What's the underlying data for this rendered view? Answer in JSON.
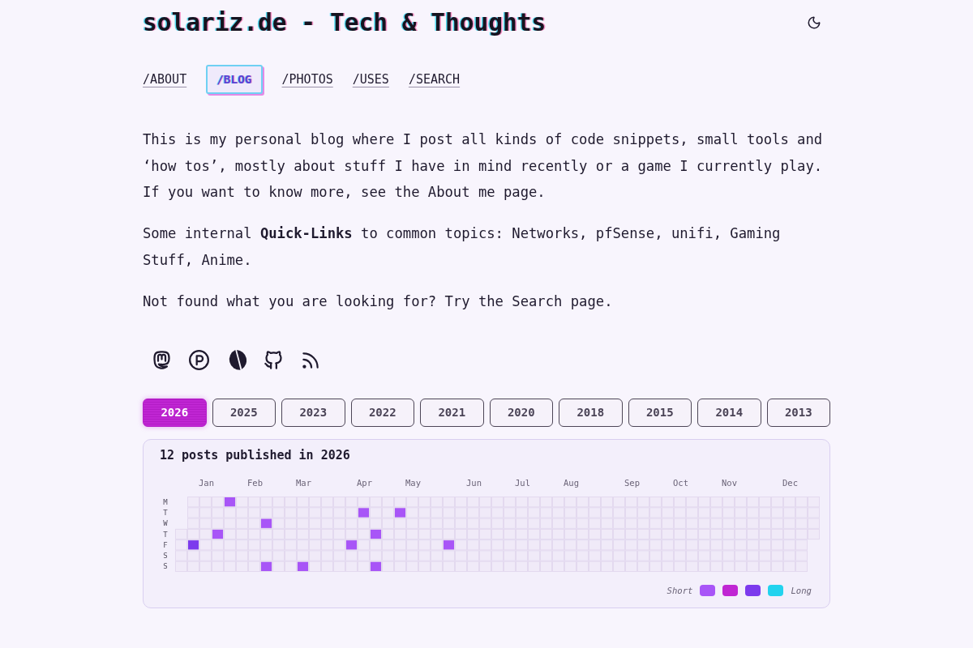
{
  "header": {
    "title": "solariz.de - Tech & Thoughts"
  },
  "nav": [
    {
      "label": "/ABOUT",
      "selected": false
    },
    {
      "label": "/BLOG",
      "selected": true
    },
    {
      "label": "/PHOTOS",
      "selected": false
    },
    {
      "label": "/USES",
      "selected": false
    },
    {
      "label": "/SEARCH",
      "selected": false
    }
  ],
  "intro": {
    "paragraphs": [
      "This is my personal blog where I post all kinds of code snippets, small tools and ‘how tos’, mostly about stuff I have in mind recently or a game I currently play. If you want to know more, see the About me page.",
      "Some internal **Quick-Links** to common topics: Networks, pfSense, unifi, Gaming Stuff, Anime.",
      "Not found what you are looking for? Try the Search page."
    ]
  },
  "years": [
    {
      "label": "2026",
      "selected": true
    },
    {
      "label": "2025",
      "selected": false
    },
    {
      "label": "2023",
      "selected": false
    },
    {
      "label": "2022",
      "selected": false
    },
    {
      "label": "2021",
      "selected": false
    },
    {
      "label": "2020",
      "selected": false
    },
    {
      "label": "2018",
      "selected": false
    },
    {
      "label": "2015",
      "selected": false
    },
    {
      "label": "2014",
      "selected": false
    },
    {
      "label": "2013",
      "selected": false
    }
  ],
  "activity": {
    "title": "12 posts published in 2026",
    "weekdays": [
      "M",
      "T",
      "W",
      "T",
      "F",
      "S",
      "S"
    ],
    "weeks": [
      {
        "kind": "start",
        "days": [
          {
            "posted": false
          },
          {
            "posted": false
          },
          {
            "posted": false
          },
          {
            "posted": false
          }
        ]
      },
      {
        "kind": "full",
        "days": [
          {
            "posted": false
          },
          {
            "posted": false
          },
          {
            "posted": false
          },
          {
            "posted": false
          },
          {
            "posted": true,
            "color": "#7c3aed"
          },
          {
            "posted": false
          },
          {
            "posted": false
          }
        ]
      },
      {
        "kind": "full",
        "month": "Jan",
        "days": [
          {
            "posted": false
          },
          {
            "posted": false
          },
          {
            "posted": false
          },
          {
            "posted": false
          },
          {
            "posted": false
          },
          {
            "posted": false
          },
          {
            "posted": false
          }
        ]
      },
      {
        "kind": "full",
        "days": [
          {
            "posted": false
          },
          {
            "posted": false
          },
          {
            "posted": false
          },
          {
            "posted": true,
            "color": "#a855f7"
          },
          {
            "posted": false
          },
          {
            "posted": false
          },
          {
            "posted": false
          }
        ]
      },
      {
        "kind": "full",
        "days": [
          {
            "posted": true,
            "color": "#a855f7"
          },
          {
            "posted": false
          },
          {
            "posted": false
          },
          {
            "posted": false
          },
          {
            "posted": false
          },
          {
            "posted": false
          },
          {
            "posted": false
          }
        ]
      },
      {
        "kind": "full",
        "days": [
          {
            "posted": false
          },
          {
            "posted": false
          },
          {
            "posted": false
          },
          {
            "posted": false
          },
          {
            "posted": false
          },
          {
            "posted": false
          },
          {
            "posted": false
          }
        ]
      },
      {
        "kind": "full",
        "month": "Feb",
        "days": [
          {
            "posted": false
          },
          {
            "posted": false
          },
          {
            "posted": false
          },
          {
            "posted": false
          },
          {
            "posted": false
          },
          {
            "posted": false
          },
          {
            "posted": false
          }
        ]
      },
      {
        "kind": "full",
        "days": [
          {
            "posted": false
          },
          {
            "posted": false
          },
          {
            "posted": true,
            "color": "#a855f7"
          },
          {
            "posted": false
          },
          {
            "posted": false
          },
          {
            "posted": false
          },
          {
            "posted": true,
            "color": "#a855f7"
          }
        ]
      },
      {
        "kind": "full",
        "days": [
          {
            "posted": false
          },
          {
            "posted": false
          },
          {
            "posted": false
          },
          {
            "posted": false
          },
          {
            "posted": false
          },
          {
            "posted": false
          },
          {
            "posted": false
          }
        ]
      },
      {
        "kind": "full",
        "days": [
          {
            "posted": false
          },
          {
            "posted": false
          },
          {
            "posted": false
          },
          {
            "posted": false
          },
          {
            "posted": false
          },
          {
            "posted": false
          },
          {
            "posted": false
          }
        ]
      },
      {
        "kind": "full",
        "month": "Mar",
        "days": [
          {
            "posted": false
          },
          {
            "posted": false
          },
          {
            "posted": false
          },
          {
            "posted": false
          },
          {
            "posted": false
          },
          {
            "posted": false
          },
          {
            "posted": true,
            "color": "#a855f7"
          }
        ]
      },
      {
        "kind": "full",
        "days": [
          {
            "posted": false
          },
          {
            "posted": false
          },
          {
            "posted": false
          },
          {
            "posted": false
          },
          {
            "posted": false
          },
          {
            "posted": false
          },
          {
            "posted": false
          }
        ]
      },
      {
        "kind": "full",
        "days": [
          {
            "posted": false
          },
          {
            "posted": false
          },
          {
            "posted": false
          },
          {
            "posted": false
          },
          {
            "posted": false
          },
          {
            "posted": false
          },
          {
            "posted": false
          }
        ]
      },
      {
        "kind": "full",
        "days": [
          {
            "posted": false
          },
          {
            "posted": false
          },
          {
            "posted": false
          },
          {
            "posted": false
          },
          {
            "posted": false
          },
          {
            "posted": false
          },
          {
            "posted": false
          }
        ]
      },
      {
        "kind": "full",
        "days": [
          {
            "posted": false
          },
          {
            "posted": false
          },
          {
            "posted": false
          },
          {
            "posted": false
          },
          {
            "posted": true,
            "color": "#a855f7"
          },
          {
            "posted": false
          },
          {
            "posted": false
          }
        ]
      },
      {
        "kind": "full",
        "month": "Apr",
        "days": [
          {
            "posted": false
          },
          {
            "posted": true,
            "color": "#a855f7"
          },
          {
            "posted": false
          },
          {
            "posted": false
          },
          {
            "posted": false
          },
          {
            "posted": false
          },
          {
            "posted": false
          }
        ]
      },
      {
        "kind": "full",
        "days": [
          {
            "posted": false
          },
          {
            "posted": false
          },
          {
            "posted": false
          },
          {
            "posted": true,
            "color": "#a855f7"
          },
          {
            "posted": false
          },
          {
            "posted": false
          },
          {
            "posted": true,
            "color": "#a855f7"
          }
        ]
      },
      {
        "kind": "full",
        "days": [
          {
            "posted": false
          },
          {
            "posted": false
          },
          {
            "posted": false
          },
          {
            "posted": false
          },
          {
            "posted": false
          },
          {
            "posted": false
          },
          {
            "posted": false
          }
        ]
      },
      {
        "kind": "full",
        "days": [
          {
            "posted": false
          },
          {
            "posted": true,
            "color": "#a855f7"
          },
          {
            "posted": false
          },
          {
            "posted": false
          },
          {
            "posted": false
          },
          {
            "posted": false
          },
          {
            "posted": false
          }
        ]
      },
      {
        "kind": "full",
        "month": "May",
        "days": [
          {
            "posted": false
          },
          {
            "posted": false
          },
          {
            "posted": false
          },
          {
            "posted": false
          },
          {
            "posted": false
          },
          {
            "posted": false
          },
          {
            "posted": false
          }
        ]
      },
      {
        "kind": "full",
        "days": [
          {
            "posted": false
          },
          {
            "posted": false
          },
          {
            "posted": false
          },
          {
            "posted": false
          },
          {
            "posted": false
          },
          {
            "posted": false
          },
          {
            "posted": false
          }
        ]
      },
      {
        "kind": "full",
        "days": [
          {
            "posted": false
          },
          {
            "posted": false
          },
          {
            "posted": false
          },
          {
            "posted": false
          },
          {
            "posted": false
          },
          {
            "posted": false
          },
          {
            "posted": false
          }
        ]
      },
      {
        "kind": "full",
        "days": [
          {
            "posted": false
          },
          {
            "posted": false
          },
          {
            "posted": false
          },
          {
            "posted": false
          },
          {
            "posted": true,
            "color": "#a855f7"
          },
          {
            "posted": false
          },
          {
            "posted": false
          }
        ]
      },
      {
        "kind": "full",
        "days": [
          {
            "posted": false
          },
          {
            "posted": false
          },
          {
            "posted": false
          },
          {
            "posted": false
          },
          {
            "posted": false
          },
          {
            "posted": false
          },
          {
            "posted": false
          }
        ]
      },
      {
        "kind": "full",
        "month": "Jun",
        "days": [
          {
            "posted": false
          },
          {
            "posted": false
          },
          {
            "posted": false
          },
          {
            "posted": false
          },
          {
            "posted": false
          },
          {
            "posted": false
          },
          {
            "posted": false
          }
        ]
      },
      {
        "kind": "full",
        "days": [
          {
            "posted": false
          },
          {
            "posted": false
          },
          {
            "posted": false
          },
          {
            "posted": false
          },
          {
            "posted": false
          },
          {
            "posted": false
          },
          {
            "posted": false
          }
        ]
      },
      {
        "kind": "full",
        "days": [
          {
            "posted": false
          },
          {
            "posted": false
          },
          {
            "posted": false
          },
          {
            "posted": false
          },
          {
            "posted": false
          },
          {
            "posted": false
          },
          {
            "posted": false
          }
        ]
      },
      {
        "kind": "full",
        "days": [
          {
            "posted": false
          },
          {
            "posted": false
          },
          {
            "posted": false
          },
          {
            "posted": false
          },
          {
            "posted": false
          },
          {
            "posted": false
          },
          {
            "posted": false
          }
        ]
      },
      {
        "kind": "full",
        "month": "Jul",
        "days": [
          {
            "posted": false
          },
          {
            "posted": false
          },
          {
            "posted": false
          },
          {
            "posted": false
          },
          {
            "posted": false
          },
          {
            "posted": false
          },
          {
            "posted": false
          }
        ]
      },
      {
        "kind": "full",
        "days": [
          {
            "posted": false
          },
          {
            "posted": false
          },
          {
            "posted": false
          },
          {
            "posted": false
          },
          {
            "posted": false
          },
          {
            "posted": false
          },
          {
            "posted": false
          }
        ]
      },
      {
        "kind": "full",
        "days": [
          {
            "posted": false
          },
          {
            "posted": false
          },
          {
            "posted": false
          },
          {
            "posted": false
          },
          {
            "posted": false
          },
          {
            "posted": false
          },
          {
            "posted": false
          }
        ]
      },
      {
        "kind": "full",
        "days": [
          {
            "posted": false
          },
          {
            "posted": false
          },
          {
            "posted": false
          },
          {
            "posted": false
          },
          {
            "posted": false
          },
          {
            "posted": false
          },
          {
            "posted": false
          }
        ]
      },
      {
        "kind": "full",
        "month": "Aug",
        "days": [
          {
            "posted": false
          },
          {
            "posted": false
          },
          {
            "posted": false
          },
          {
            "posted": false
          },
          {
            "posted": false
          },
          {
            "posted": false
          },
          {
            "posted": false
          }
        ]
      },
      {
        "kind": "full",
        "days": [
          {
            "posted": false
          },
          {
            "posted": false
          },
          {
            "posted": false
          },
          {
            "posted": false
          },
          {
            "posted": false
          },
          {
            "posted": false
          },
          {
            "posted": false
          }
        ]
      },
      {
        "kind": "full",
        "days": [
          {
            "posted": false
          },
          {
            "posted": false
          },
          {
            "posted": false
          },
          {
            "posted": false
          },
          {
            "posted": false
          },
          {
            "posted": false
          },
          {
            "posted": false
          }
        ]
      },
      {
        "kind": "full",
        "days": [
          {
            "posted": false
          },
          {
            "posted": false
          },
          {
            "posted": false
          },
          {
            "posted": false
          },
          {
            "posted": false
          },
          {
            "posted": false
          },
          {
            "posted": false
          }
        ]
      },
      {
        "kind": "full",
        "days": [
          {
            "posted": false
          },
          {
            "posted": false
          },
          {
            "posted": false
          },
          {
            "posted": false
          },
          {
            "posted": false
          },
          {
            "posted": false
          },
          {
            "posted": false
          }
        ]
      },
      {
        "kind": "full",
        "month": "Sep",
        "days": [
          {
            "posted": false
          },
          {
            "posted": false
          },
          {
            "posted": false
          },
          {
            "posted": false
          },
          {
            "posted": false
          },
          {
            "posted": false
          },
          {
            "posted": false
          }
        ]
      },
      {
        "kind": "full",
        "days": [
          {
            "posted": false
          },
          {
            "posted": false
          },
          {
            "posted": false
          },
          {
            "posted": false
          },
          {
            "posted": false
          },
          {
            "posted": false
          },
          {
            "posted": false
          }
        ]
      },
      {
        "kind": "full",
        "days": [
          {
            "posted": false
          },
          {
            "posted": false
          },
          {
            "posted": false
          },
          {
            "posted": false
          },
          {
            "posted": false
          },
          {
            "posted": false
          },
          {
            "posted": false
          }
        ]
      },
      {
        "kind": "full",
        "days": [
          {
            "posted": false
          },
          {
            "posted": false
          },
          {
            "posted": false
          },
          {
            "posted": false
          },
          {
            "posted": false
          },
          {
            "posted": false
          },
          {
            "posted": false
          }
        ]
      },
      {
        "kind": "full",
        "month": "Oct",
        "days": [
          {
            "posted": false
          },
          {
            "posted": false
          },
          {
            "posted": false
          },
          {
            "posted": false
          },
          {
            "posted": false
          },
          {
            "posted": false
          },
          {
            "posted": false
          }
        ]
      },
      {
        "kind": "full",
        "days": [
          {
            "posted": false
          },
          {
            "posted": false
          },
          {
            "posted": false
          },
          {
            "posted": false
          },
          {
            "posted": false
          },
          {
            "posted": false
          },
          {
            "posted": false
          }
        ]
      },
      {
        "kind": "full",
        "days": [
          {
            "posted": false
          },
          {
            "posted": false
          },
          {
            "posted": false
          },
          {
            "posted": false
          },
          {
            "posted": false
          },
          {
            "posted": false
          },
          {
            "posted": false
          }
        ]
      },
      {
        "kind": "full",
        "days": [
          {
            "posted": false
          },
          {
            "posted": false
          },
          {
            "posted": false
          },
          {
            "posted": false
          },
          {
            "posted": false
          },
          {
            "posted": false
          },
          {
            "posted": false
          }
        ]
      },
      {
        "kind": "full",
        "month": "Nov",
        "days": [
          {
            "posted": false
          },
          {
            "posted": false
          },
          {
            "posted": false
          },
          {
            "posted": false
          },
          {
            "posted": false
          },
          {
            "posted": false
          },
          {
            "posted": false
          }
        ]
      },
      {
        "kind": "full",
        "days": [
          {
            "posted": false
          },
          {
            "posted": false
          },
          {
            "posted": false
          },
          {
            "posted": false
          },
          {
            "posted": false
          },
          {
            "posted": false
          },
          {
            "posted": false
          }
        ]
      },
      {
        "kind": "full",
        "days": [
          {
            "posted": false
          },
          {
            "posted": false
          },
          {
            "posted": false
          },
          {
            "posted": false
          },
          {
            "posted": false
          },
          {
            "posted": false
          },
          {
            "posted": false
          }
        ]
      },
      {
        "kind": "full",
        "days": [
          {
            "posted": false
          },
          {
            "posted": false
          },
          {
            "posted": false
          },
          {
            "posted": false
          },
          {
            "posted": false
          },
          {
            "posted": false
          },
          {
            "posted": false
          }
        ]
      },
      {
        "kind": "full",
        "days": [
          {
            "posted": false
          },
          {
            "posted": false
          },
          {
            "posted": false
          },
          {
            "posted": false
          },
          {
            "posted": false
          },
          {
            "posted": false
          },
          {
            "posted": false
          }
        ]
      },
      {
        "kind": "full",
        "month": "Dec",
        "days": [
          {
            "posted": false
          },
          {
            "posted": false
          },
          {
            "posted": false
          },
          {
            "posted": false
          },
          {
            "posted": false
          },
          {
            "posted": false
          },
          {
            "posted": false
          }
        ]
      },
      {
        "kind": "full",
        "days": [
          {
            "posted": false
          },
          {
            "posted": false
          },
          {
            "posted": false
          },
          {
            "posted": false
          },
          {
            "posted": false
          },
          {
            "posted": false
          },
          {
            "posted": false
          }
        ]
      },
      {
        "kind": "full",
        "days": [
          {
            "posted": false
          },
          {
            "posted": false
          },
          {
            "posted": false
          },
          {
            "posted": false
          }
        ]
      }
    ],
    "legend": {
      "low": "Short",
      "high": "Long",
      "swatches": [
        {
          "color": "#a855f7"
        },
        {
          "color": "#c026d3"
        },
        {
          "color": "#7c3aed"
        },
        {
          "color": "#22d3ee"
        }
      ]
    }
  }
}
